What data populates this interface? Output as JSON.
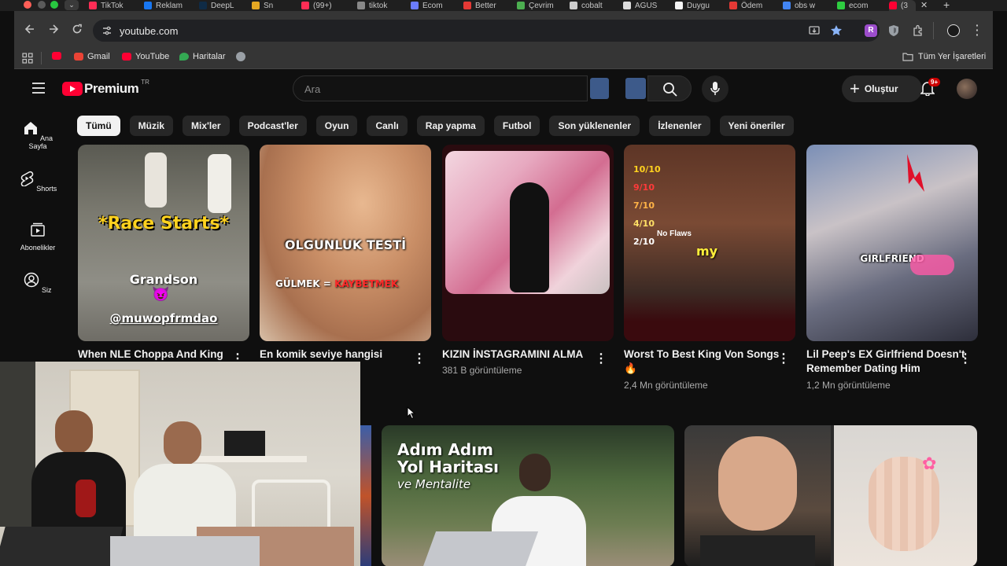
{
  "browser": {
    "tabs": [
      {
        "label": "TikTok",
        "color": "#ff2d55"
      },
      {
        "label": "Reklam",
        "color": "#1877f2"
      },
      {
        "label": "DeepL",
        "color": "#0f2b46"
      },
      {
        "label": "Sn",
        "color": "#e5a823"
      },
      {
        "label": "(99+)",
        "color": "#ff2d55"
      },
      {
        "label": "tiktok",
        "color": "#888888"
      },
      {
        "label": "Ecom",
        "color": "#6b7cff"
      },
      {
        "label": "Better",
        "color": "#e53935"
      },
      {
        "label": "Çevrim",
        "color": "#4caf50"
      },
      {
        "label": "cobalt",
        "color": "#cccccc"
      },
      {
        "label": "AGUS",
        "color": "#dddddd"
      },
      {
        "label": "Duygu",
        "color": "#f5f5f5"
      },
      {
        "label": "Ödem",
        "color": "#e53935"
      },
      {
        "label": "obs w",
        "color": "#4285f4"
      },
      {
        "label": "ecom",
        "color": "#2ecc40"
      },
      {
        "label": "(3",
        "color": "#ff0033"
      }
    ],
    "url": "youtube.com",
    "bookmarks": [
      {
        "label": "",
        "color": "#ff0033"
      },
      {
        "label": "Gmail",
        "color": "#ea4335"
      },
      {
        "label": "YouTube",
        "color": "#ff0033"
      },
      {
        "label": "Haritalar",
        "color": "#34a853"
      }
    ],
    "all_bookmarks": "Tüm Yer İşaretleri"
  },
  "youtube": {
    "logo": "Premium",
    "logo_region": "TR",
    "search_placeholder": "Ara",
    "create_label": "Oluştur",
    "notification_count": "9+",
    "chips": [
      "Tümü",
      "Müzik",
      "Mix'ler",
      "Podcast'ler",
      "Oyun",
      "Canlı",
      "Rap yapma",
      "Futbol",
      "Son yüklenenler",
      "İzlenenler",
      "Yeni öneriler"
    ],
    "guide": [
      {
        "label": "Ana Sayfa",
        "icon": "home-icon"
      },
      {
        "label": "Shorts",
        "icon": "shorts-icon"
      },
      {
        "label": "Abonelikler",
        "icon": "subscriptions-icon"
      },
      {
        "label": "Siz",
        "icon": "you-icon"
      }
    ],
    "videos": [
      {
        "title": "When NLE Choppa And King",
        "title2": "",
        "views": "",
        "overlay1": "*Race Starts*",
        "overlay2": "Grandson",
        "overlay3": "@muwopfrmdao"
      },
      {
        "title": "En komik seviye hangisi",
        "title2": "",
        "views": "",
        "overlay1": "OLGUNLUK TESTİ",
        "overlay2": "GÜLMEK =",
        "overlay3": "KAYBETMEK"
      },
      {
        "title": "KIZIN İNSTAGRAMINI ALMA",
        "title2": "",
        "views": "381 B görüntüleme"
      },
      {
        "title": "Worst To Best King Von Songs",
        "title2": "🔥",
        "views": "2,4 Mn görüntüleme",
        "ranks": [
          "10/10",
          "9/10",
          "7/10",
          "4/10",
          "2/10"
        ],
        "noflaws": "No Flaws",
        "caption": "my"
      },
      {
        "title": "Lil Peep's EX Girlfriend Doesn't",
        "title2": "Remember Dating Him",
        "views": "1,2 Mn görüntüleme",
        "overlay1": "GIRLFRIEND"
      }
    ],
    "row2": [
      {
        "overlay1": "Adım Adım",
        "overlay2": "Yol Haritası",
        "overlay3": "ve Mentalite"
      }
    ]
  }
}
